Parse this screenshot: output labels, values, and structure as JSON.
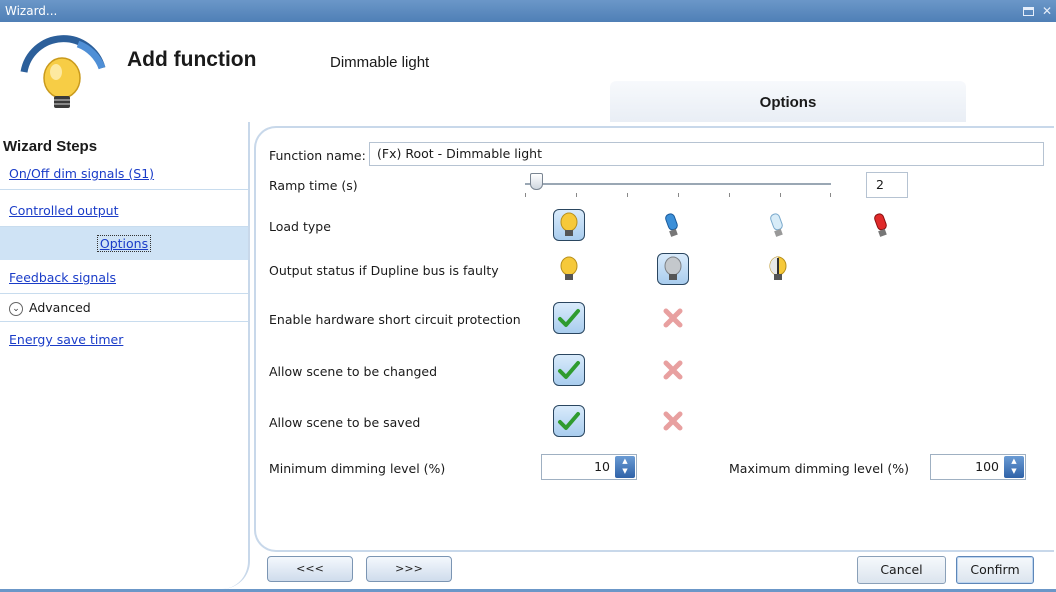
{
  "window": {
    "title": "Wizard..."
  },
  "header": {
    "title": "Add function",
    "subtitle": "Dimmable light",
    "tab": "Options"
  },
  "sidebar": {
    "title": "Wizard Steps",
    "items": [
      {
        "label": "On/Off dim signals (S1)"
      },
      {
        "label": "Controlled output"
      },
      {
        "label": "Options"
      },
      {
        "label": "Feedback signals"
      },
      {
        "label": "Advanced"
      },
      {
        "label": "Energy save timer"
      }
    ]
  },
  "form": {
    "function_name_label": "Function name:",
    "function_name_value": "(Fx) Root - Dimmable light",
    "ramp_label": "Ramp time (s)",
    "ramp_value": "2",
    "load_type_label": "Load type",
    "output_status_label": "Output status if Dupline bus is faulty",
    "short_circuit_label": "Enable hardware short circuit protection",
    "scene_changed_label": "Allow scene to be changed",
    "scene_saved_label": "Allow scene to be saved",
    "min_dim_label": "Minimum dimming level (%)",
    "min_dim_value": "10",
    "max_dim_label": "Maximum dimming level (%)",
    "max_dim_value": "100"
  },
  "buttons": {
    "prev": "<<<",
    "next": ">>>",
    "cancel": "Cancel",
    "confirm": "Confirm"
  },
  "colors": {
    "titlebar": "#5b8bc0",
    "accent": "#1a3cc8",
    "selected_step": "#cfe3f5"
  }
}
